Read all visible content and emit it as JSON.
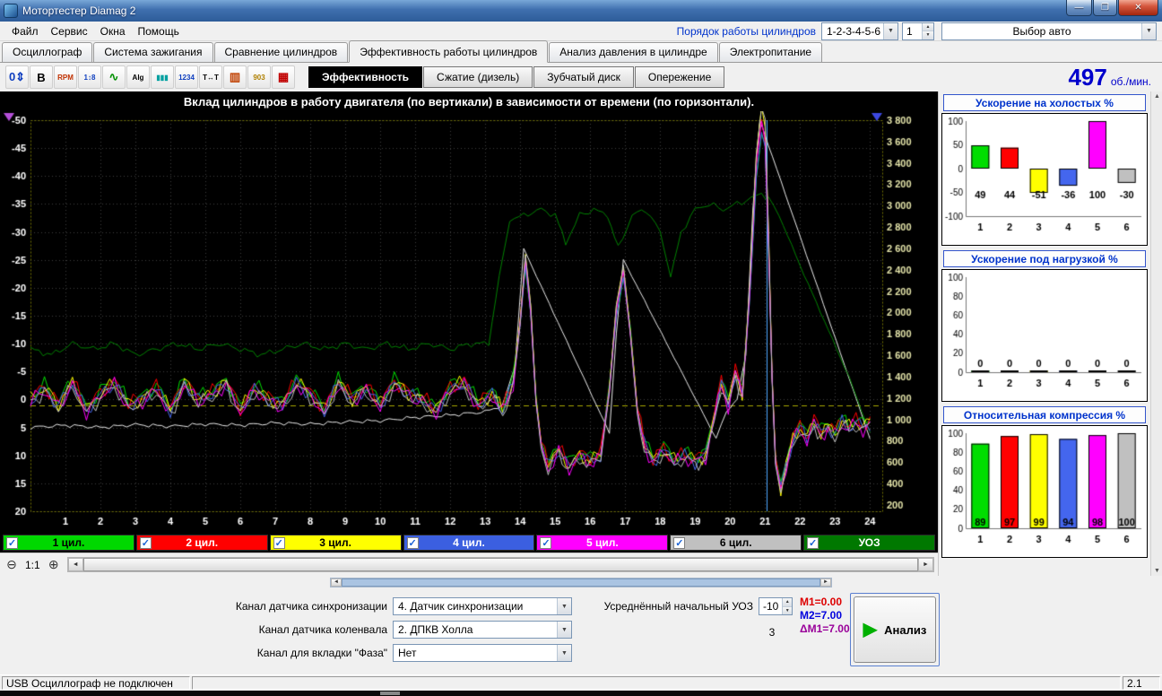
{
  "window": {
    "title": "Мотортестер Diamag 2"
  },
  "glyphs": {
    "check": "✓",
    "dropdown": "▼",
    "up": "▲",
    "down": "▼",
    "left": "◄",
    "right": "►",
    "minimize": "—",
    "maximize": "❐",
    "close": "✕",
    "play": "▶",
    "scroll_up": "▲",
    "scroll_down": "▼"
  },
  "colors": {
    "cyl": [
      "#00dd00",
      "#ff0000",
      "#ffff00",
      "#4466ee",
      "#ff00ff",
      "#c0c0c0"
    ],
    "uoz_line": "#008000",
    "accent": "#0000cc"
  },
  "menubar": {
    "items": [
      "Файл",
      "Сервис",
      "Окна",
      "Помощь"
    ],
    "firing_order_label": "Порядок работы цилиндров",
    "firing_order_value": "1-2-3-4-5-6",
    "cylinder_count": "1",
    "car_selector": "Выбор авто"
  },
  "tabs": [
    "Осциллограф",
    "Система зажигания",
    "Сравнение цилиндров",
    "Эффективность работы цилиндров",
    "Анализ давления в цилиндре",
    "Электропитание"
  ],
  "active_tab_index": 3,
  "toolbar": {
    "icons": [
      {
        "name": "zero-offset-icon",
        "glyph": "0⇕",
        "color": "#1040c0"
      },
      {
        "name": "amplitude-icon",
        "glyph": "B",
        "color": "#000000"
      },
      {
        "name": "rpm-icon",
        "glyph": "RPM",
        "color": "#c03000"
      },
      {
        "name": "range-icon",
        "glyph": "1↕8",
        "color": "#1040c0"
      },
      {
        "name": "waveform-icon",
        "glyph": "∿",
        "color": "#009000"
      },
      {
        "name": "algorithm-icon",
        "glyph": "Alg",
        "color": "#000000"
      },
      {
        "name": "cylinder-bars-icon",
        "glyph": "▮▮▮",
        "color": "#00a0a0"
      },
      {
        "name": "firing-order-icon",
        "glyph": "1234",
        "color": "#1040c0"
      },
      {
        "name": "time-markers-icon",
        "glyph": "T↔T",
        "color": "#000000"
      },
      {
        "name": "engine-icon",
        "glyph": "▥",
        "color": "#c04000"
      },
      {
        "name": "gauge-903-icon",
        "glyph": "903",
        "color": "#b08000"
      },
      {
        "name": "table-icon",
        "glyph": "▦",
        "color": "#c00000"
      }
    ],
    "subtabs": [
      "Эффективность",
      "Сжатие (дизель)",
      "Зубчатый диск",
      "Опережение"
    ],
    "active_subtab": 0,
    "rpm_value": "497",
    "rpm_unit": "об./мин."
  },
  "main_chart": {
    "title": "Вклад цилиндров в работу двигателя (по вертикали) в зависимости от времени (по горизонтали).",
    "x_max": 24.35,
    "x_ticks": [
      1,
      2,
      3,
      4,
      5,
      6,
      7,
      8,
      9,
      10,
      11,
      12,
      13,
      14,
      15,
      16,
      17,
      18,
      19,
      20,
      21,
      22,
      23,
      24
    ],
    "left_axis": {
      "min": -50,
      "max": 20,
      "ticks": [
        -50,
        -45,
        -40,
        -35,
        -30,
        -25,
        -20,
        -15,
        -10,
        -5,
        0,
        5,
        10,
        15,
        20
      ]
    },
    "right_axis": {
      "values": [
        3800,
        3600,
        3400,
        3200,
        3000,
        2800,
        2600,
        2400,
        2200,
        2000,
        1800,
        1600,
        1400,
        1200,
        1000,
        800,
        600,
        400,
        200
      ],
      "labels": [
        "3 800",
        "3 600",
        "3 400",
        "3 200",
        "3 000",
        "2 800",
        "2 600",
        "2 400",
        "2 200",
        "2 000",
        "1 800",
        "1 600",
        "1 400",
        "1 200",
        "1 000",
        "800",
        "600",
        "400",
        "200"
      ]
    },
    "yellow_line_y": 1,
    "marker_x": 21.05,
    "series": {
      "cylinder_base": [
        [
          0,
          0
        ],
        [
          0.4,
          -2
        ],
        [
          0.8,
          1
        ],
        [
          1.2,
          -3
        ],
        [
          1.6,
          2
        ],
        [
          2,
          -1
        ],
        [
          2.4,
          -3
        ],
        [
          2.8,
          1
        ],
        [
          3.2,
          0
        ],
        [
          3.6,
          -2
        ],
        [
          4,
          2
        ],
        [
          4.4,
          -3
        ],
        [
          4.8,
          0
        ],
        [
          5.2,
          -1
        ],
        [
          5.6,
          -3
        ],
        [
          6,
          2
        ],
        [
          6.4,
          -2
        ],
        [
          6.8,
          0
        ],
        [
          7.2,
          1
        ],
        [
          7.6,
          -3
        ],
        [
          8,
          -1
        ],
        [
          8.4,
          2
        ],
        [
          8.8,
          -3
        ],
        [
          9.2,
          0
        ],
        [
          9.6,
          -2
        ],
        [
          10,
          1
        ],
        [
          10.4,
          -3
        ],
        [
          10.8,
          -1
        ],
        [
          11.2,
          0
        ],
        [
          11.6,
          2
        ],
        [
          12,
          -2
        ],
        [
          12.4,
          -3
        ],
        [
          12.8,
          1
        ],
        [
          13.2,
          -1
        ],
        [
          13.5,
          2
        ],
        [
          13.8,
          -3
        ],
        [
          14,
          -14
        ],
        [
          14.15,
          -25
        ],
        [
          14.3,
          -16
        ],
        [
          14.45,
          0
        ],
        [
          14.6,
          8
        ],
        [
          14.8,
          12
        ],
        [
          15.1,
          9
        ],
        [
          15.4,
          12
        ],
        [
          15.7,
          10
        ],
        [
          16,
          11
        ],
        [
          16.3,
          10
        ],
        [
          16.55,
          -2
        ],
        [
          16.75,
          -16
        ],
        [
          16.95,
          -23
        ],
        [
          17.15,
          -12
        ],
        [
          17.35,
          2
        ],
        [
          17.55,
          8
        ],
        [
          17.8,
          11
        ],
        [
          18.1,
          9
        ],
        [
          18.4,
          11
        ],
        [
          18.7,
          10
        ],
        [
          19,
          11
        ],
        [
          19.3,
          10
        ],
        [
          19.55,
          3
        ],
        [
          19.75,
          -3
        ],
        [
          19.95,
          1
        ],
        [
          20.15,
          -5
        ],
        [
          20.35,
          -1
        ],
        [
          20.55,
          -18
        ],
        [
          20.75,
          -42
        ],
        [
          20.9,
          -50
        ],
        [
          21,
          -47
        ],
        [
          21.1,
          -28
        ],
        [
          21.2,
          -4
        ],
        [
          21.3,
          11
        ],
        [
          21.45,
          16
        ],
        [
          21.6,
          12
        ],
        [
          21.8,
          7
        ],
        [
          22,
          5
        ],
        [
          22.2,
          7
        ],
        [
          22.4,
          4
        ],
        [
          22.6,
          6
        ],
        [
          22.8,
          5
        ],
        [
          23,
          6
        ],
        [
          23.2,
          4
        ],
        [
          23.4,
          5
        ],
        [
          23.6,
          4
        ],
        [
          23.8,
          5
        ],
        [
          24,
          4
        ]
      ],
      "uoz": [
        [
          0,
          -9
        ],
        [
          0.6,
          -8
        ],
        [
          1.2,
          -10
        ],
        [
          1.8,
          -9
        ],
        [
          2.4,
          -10
        ],
        [
          3,
          -8
        ],
        [
          3.6,
          -9
        ],
        [
          4.2,
          -10
        ],
        [
          4.8,
          -9
        ],
        [
          5.4,
          -10
        ],
        [
          6,
          -9
        ],
        [
          6.6,
          -8
        ],
        [
          7.2,
          -9
        ],
        [
          7.8,
          -10
        ],
        [
          8.4,
          -9
        ],
        [
          9,
          -10
        ],
        [
          9.6,
          -9
        ],
        [
          10.2,
          -10
        ],
        [
          10.8,
          -9
        ],
        [
          11.4,
          -10
        ],
        [
          12,
          -9
        ],
        [
          12.6,
          -10
        ],
        [
          13.1,
          -10
        ],
        [
          13.4,
          -22
        ],
        [
          13.7,
          -32
        ],
        [
          14.1,
          -33
        ],
        [
          14.6,
          -34
        ],
        [
          15,
          -33
        ],
        [
          15.3,
          -28
        ],
        [
          15.7,
          -33
        ],
        [
          16.1,
          -34
        ],
        [
          16.5,
          -33
        ],
        [
          16.8,
          -27
        ],
        [
          17.2,
          -33
        ],
        [
          17.6,
          -34
        ],
        [
          18,
          -30
        ],
        [
          18.3,
          -22
        ],
        [
          18.6,
          -30
        ],
        [
          19,
          -34
        ],
        [
          19.4,
          -35
        ],
        [
          19.8,
          -34
        ],
        [
          20.2,
          -35
        ],
        [
          20.6,
          -36
        ],
        [
          20.9,
          -37
        ],
        [
          21.1,
          -36
        ],
        [
          21.4,
          -33
        ],
        [
          22,
          -24
        ],
        [
          22.7,
          -14
        ],
        [
          23.4,
          -4
        ],
        [
          24,
          6
        ]
      ],
      "white": [
        [
          0,
          5
        ],
        [
          1,
          4.6
        ],
        [
          2,
          5
        ],
        [
          3,
          4.5
        ],
        [
          4,
          4.8
        ],
        [
          5,
          4.4
        ],
        [
          6,
          4.6
        ],
        [
          7,
          4.2
        ],
        [
          8,
          4.4
        ],
        [
          9,
          4
        ],
        [
          10,
          3.8
        ],
        [
          11,
          3.2
        ],
        [
          12,
          2.8
        ],
        [
          13,
          2.2
        ],
        [
          13.5,
          1
        ],
        [
          13.85,
          -6
        ],
        [
          14.1,
          -27
        ],
        [
          16.55,
          6
        ],
        [
          16.75,
          -12
        ],
        [
          16.95,
          -25
        ],
        [
          19.6,
          7
        ],
        [
          19.9,
          2
        ],
        [
          20.2,
          0
        ],
        [
          20.45,
          -8
        ],
        [
          20.65,
          -34
        ],
        [
          20.85,
          -50
        ],
        [
          24,
          7
        ]
      ]
    }
  },
  "legend": [
    {
      "label": "1 цил.",
      "color": "#00d800",
      "text": "#000000"
    },
    {
      "label": "2 цил.",
      "color": "#ff0000",
      "text": "#ffffff"
    },
    {
      "label": "3 цил.",
      "color": "#ffff00",
      "text": "#000000"
    },
    {
      "label": "4 цил.",
      "color": "#3b5fe0",
      "text": "#ffffff"
    },
    {
      "label": "5 цил.",
      "color": "#ff00ff",
      "text": "#ffffff"
    },
    {
      "label": "6 цил.",
      "color": "#c0c0c0",
      "text": "#000000"
    },
    {
      "label": "УОЗ",
      "color": "#007800",
      "text": "#ffffff"
    }
  ],
  "zoom": {
    "out": "⊖",
    "ratio": "1:1",
    "in": "⊕"
  },
  "side_charts": [
    {
      "type": "bar",
      "title": "Ускорение на холостых %",
      "ymin": -100,
      "ymax": 100,
      "ticks": [
        100,
        50,
        0,
        -50,
        -100
      ],
      "categories": [
        "1",
        "2",
        "3",
        "4",
        "5",
        "6"
      ],
      "values": [
        49,
        44,
        -51,
        -36,
        100,
        -30
      ],
      "label_mode": "row",
      "label_y": -62
    },
    {
      "type": "bar",
      "title": "Ускорение под нагрузкой %",
      "ymin": 0,
      "ymax": 100,
      "ticks": [
        100,
        80,
        60,
        40,
        20,
        0
      ],
      "categories": [
        "1",
        "2",
        "3",
        "4",
        "5",
        "6"
      ],
      "values": [
        0,
        0,
        0,
        0,
        0,
        0
      ],
      "label_mode": "baseline"
    },
    {
      "type": "bar",
      "title": "Относительная компрессия %",
      "ymin": 0,
      "ymax": 100,
      "ticks": [
        100,
        80,
        60,
        40,
        20,
        0
      ],
      "categories": [
        "1",
        "2",
        "3",
        "4",
        "5",
        "6"
      ],
      "values": [
        89,
        97,
        99,
        94,
        98,
        100
      ],
      "label_mode": "inside"
    }
  ],
  "bottom_panel": {
    "sync_channel": {
      "label": "Канал датчика синхронизации",
      "value": "4.  Датчик синхронизации"
    },
    "crank_channel": {
      "label": "Канал датчика коленвала",
      "value": "2.  ДПКВ Холла"
    },
    "phase_channel": {
      "label": "Канал для вкладки \"Фаза\"",
      "value": "Нет"
    },
    "uoz": {
      "label": "Усреднённый начальный УОЗ",
      "value": "-10",
      "extra": "3"
    },
    "measurements": {
      "m1": "M1=0.00",
      "m2": "M2=7.00",
      "dm1": "ΔM1=7.00"
    },
    "analyze_label": "Анализ"
  },
  "status_bar": {
    "device": "USB Осциллограф не подключен",
    "version": "2.1"
  }
}
